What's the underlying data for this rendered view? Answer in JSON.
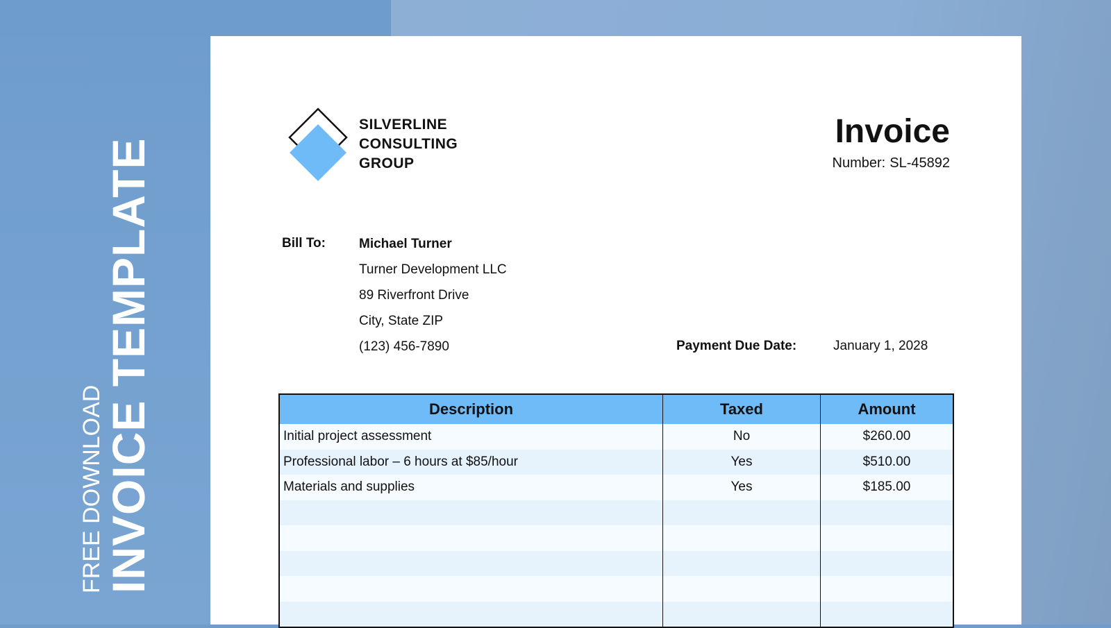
{
  "banner": {
    "line1": "FREE DOWNLOAD",
    "line2": "INVOICE TEMPLATE"
  },
  "company": {
    "lines": [
      "SILVERLINE",
      "CONSULTING",
      "GROUP"
    ],
    "logo_icon": "diamond-logo-icon",
    "logo_color": "#6ebbf7"
  },
  "invoice": {
    "title": "Invoice",
    "number_label": "Number:",
    "number": "SL-45892"
  },
  "bill_to": {
    "label": "Bill To:",
    "name": "Michael Turner",
    "company": "Turner Development LLC",
    "address": "89 Riverfront Drive",
    "city": "City, State ZIP",
    "phone": "(123) 456-7890"
  },
  "payment": {
    "due_label": "Payment Due Date:",
    "due_date": "January 1, 2028"
  },
  "table": {
    "headers": [
      "Description",
      "Taxed",
      "Amount"
    ],
    "rows": [
      [
        "Initial project assessment",
        "No",
        "$260.00"
      ],
      [
        "Professional labor – 6 hours at $85/hour",
        "Yes",
        "$510.00"
      ],
      [
        "Materials and supplies",
        "Yes",
        "$185.00"
      ],
      [
        "",
        "",
        ""
      ],
      [
        "",
        "",
        ""
      ],
      [
        "",
        "",
        ""
      ],
      [
        "",
        "",
        ""
      ],
      [
        "",
        "",
        ""
      ]
    ],
    "header_color": "#6ebbf7"
  }
}
